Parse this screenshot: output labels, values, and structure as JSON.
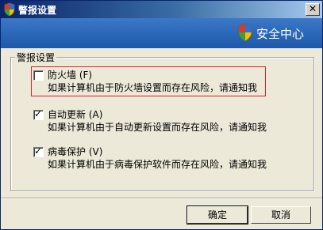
{
  "window": {
    "title": "警报设置",
    "close_glyph": "✕"
  },
  "header": {
    "brand": "安全中心"
  },
  "group": {
    "legend": "警报设置"
  },
  "options": [
    {
      "label": "防火墙 (F)",
      "description": "如果计算机由于防火墙设置而存在风险，请通知我",
      "checked": false
    },
    {
      "label": "自动更新 (A)",
      "description": "如果计算机由于自动更新设置而存在风险，请通知我",
      "checked": true
    },
    {
      "label": "病毒保护 (V)",
      "description": "如果计算机由于病毒保护软件而存在风险，请通知我",
      "checked": true
    }
  ],
  "buttons": {
    "ok": "确定",
    "cancel": "取消"
  },
  "icons": {
    "title": "shield-icon",
    "header": "shield-icon"
  },
  "colors": {
    "title_bar": "#0a246a",
    "header_bg": "#1d58aa",
    "highlight": "#e02020"
  }
}
